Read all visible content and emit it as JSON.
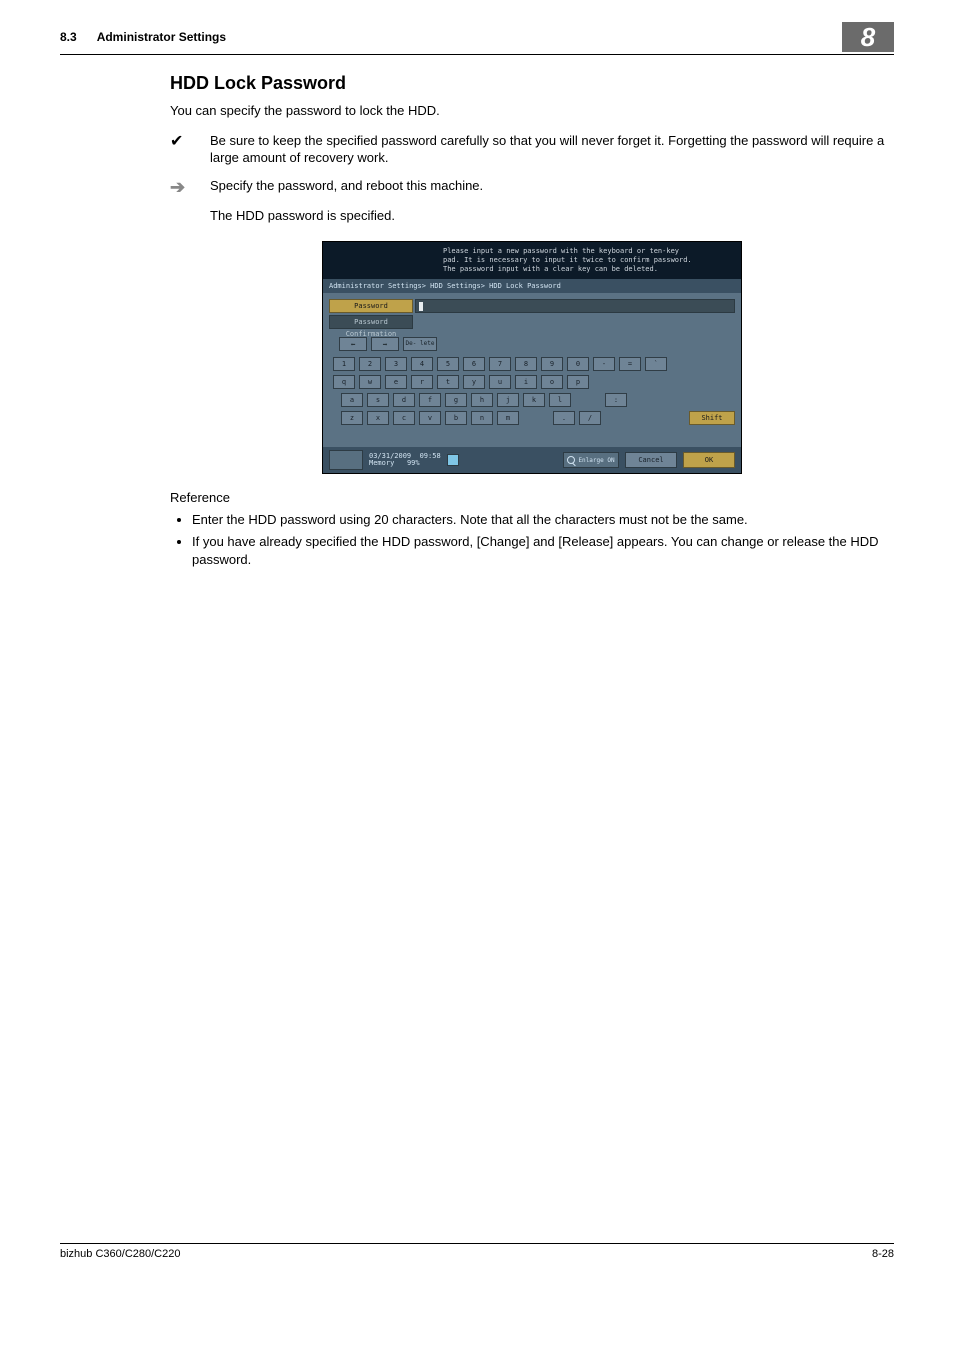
{
  "header": {
    "section_number": "8.3",
    "section_title": "Administrator Settings",
    "chapter_tab": "8"
  },
  "heading": "HDD Lock Password",
  "intro": "You can specify the password to lock the HDD.",
  "check_item": "Be sure to keep the specified password carefully so that you will never forget it. Forgetting the password will require a large amount of recovery work.",
  "arrow_item": "Specify the password, and reboot this machine.",
  "arrow_sub": "The HDD password is specified.",
  "device": {
    "top_line1": "Please input a new password with the keyboard or ten-key",
    "top_line2": "pad.  It is necessary to input it twice to confirm password.",
    "top_line3": "The password input with a clear key can be deleted.",
    "breadcrumb": "Administrator Settings> HDD Settings> HDD Lock Password",
    "password_tab": "Password",
    "confirm_tab": "Password Confirmation",
    "delete_btn": "De- lete",
    "rows": {
      "r1": [
        "1",
        "2",
        "3",
        "4",
        "5",
        "6",
        "7",
        "8",
        "9",
        "0",
        "-",
        "=",
        "`"
      ],
      "r2": [
        "q",
        "w",
        "e",
        "r",
        "t",
        "y",
        "u",
        "i",
        "o",
        "p"
      ],
      "r3": [
        "a",
        "s",
        "d",
        "f",
        "g",
        "h",
        "j",
        "k",
        "l"
      ],
      "r4": [
        "z",
        "x",
        "c",
        "v",
        "b",
        "n",
        "m"
      ]
    },
    "r3_extra": ":",
    "r4_extra": [
      ".",
      "/"
    ],
    "shift": "Shift",
    "status_date": "03/31/2009",
    "status_time": "09:58",
    "status_mem_label": "Memory",
    "status_mem_value": "99%",
    "enlarge": "Enlarge ON",
    "cancel": "Cancel",
    "ok": "OK"
  },
  "reference_heading": "Reference",
  "reference_items": [
    "Enter the HDD password using 20 characters. Note that all the characters must not be the same.",
    "If you have already specified the HDD password, [Change] and [Release] appears. You can change or release the HDD password."
  ],
  "footer": {
    "left": "bizhub C360/C280/C220",
    "right": "8-28"
  }
}
